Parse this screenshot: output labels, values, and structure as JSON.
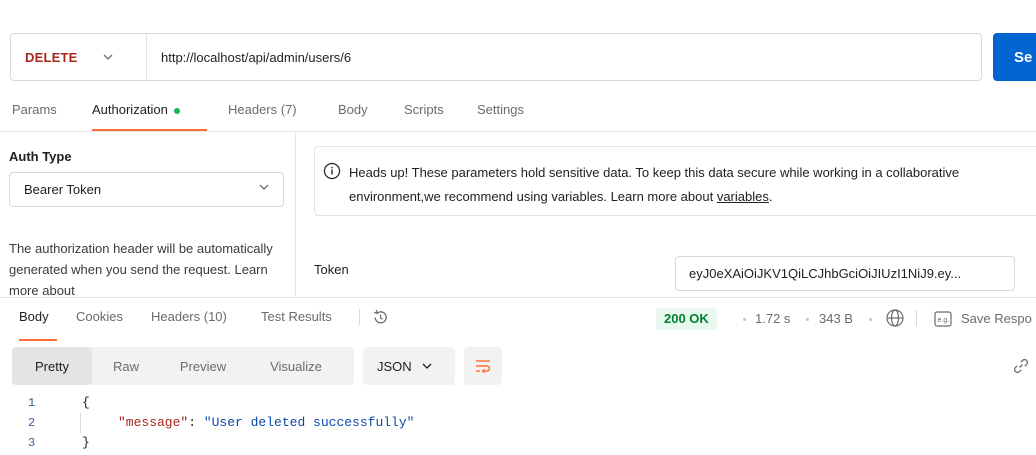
{
  "request": {
    "method": "DELETE",
    "url": "http://localhost/api/admin/users/6",
    "send_label": "Se"
  },
  "request_tabs": [
    {
      "label": "Params"
    },
    {
      "label": "Authorization"
    },
    {
      "label": "Headers (7)"
    },
    {
      "label": "Body"
    },
    {
      "label": "Scripts"
    },
    {
      "label": "Settings"
    }
  ],
  "auth": {
    "type_label": "Auth Type",
    "type_value": "Bearer Token",
    "description": "The authorization header will be automatically generated when you send the request. Learn more about",
    "info_text": "Heads up! These parameters hold sensitive data. To keep this data secure while working in a collaborative environment,we recommend using variables. Learn more about",
    "info_link": "variables",
    "info_end": ".",
    "token_label": "Token",
    "token_value": "eyJ0eXAiOiJKV1QiLCJhbGciOiJIUzI1NiJ9.ey..."
  },
  "response_tabs": [
    {
      "label": "Body"
    },
    {
      "label": "Cookies"
    },
    {
      "label": "Headers (10)"
    },
    {
      "label": "Test Results"
    }
  ],
  "response": {
    "status": "200 OK",
    "time": "1.72 s",
    "size": "343 B",
    "save_label": "Save Respo"
  },
  "format": {
    "modes": [
      "Pretty",
      "Raw",
      "Preview",
      "Visualize"
    ],
    "language": "JSON"
  },
  "body_lines": [
    {
      "n": "1",
      "text": "{"
    },
    {
      "n": "2",
      "key": "\"message\"",
      "sep": ": ",
      "value": "\"User deleted successfully\""
    },
    {
      "n": "3",
      "text": "}"
    }
  ],
  "colors": {
    "method": "#a8271c",
    "send": "#0265d2",
    "active_tab_underline": "#ff6c37",
    "status_ok": "#007f31",
    "auth_dot": "#0cbb52"
  },
  "icons": [
    "chevron-down-icon",
    "info-icon",
    "history-icon",
    "globe-icon",
    "save-response-icon",
    "wrap-lines-icon",
    "link-icon"
  ]
}
